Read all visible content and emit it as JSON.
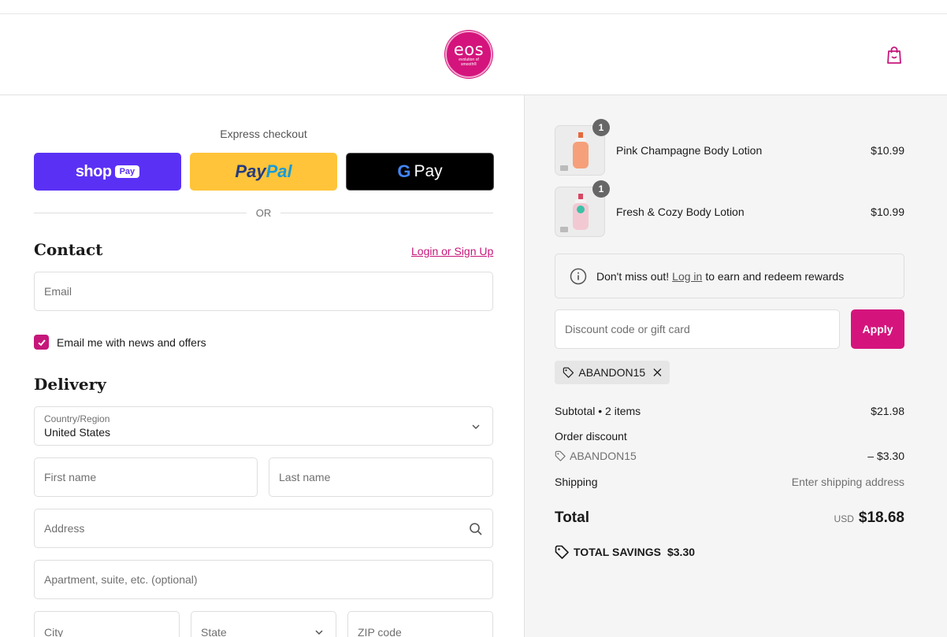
{
  "header": {
    "logo_word": "eos",
    "logo_tagline": "evolution of smooth®",
    "cart_icon": "shopping-bag-icon"
  },
  "express": {
    "title": "Express checkout",
    "shop_pay": {
      "word": "shop",
      "pill": "Pay"
    },
    "paypal": {
      "pay": "Pay",
      "pal": "Pal"
    },
    "gpay": {
      "g": "G",
      "pay": "Pay"
    },
    "or": "OR"
  },
  "contact": {
    "title": "Contact",
    "login_link": "Login or Sign Up",
    "email_placeholder": "Email",
    "newsletter_label": "Email me with news and offers",
    "newsletter_checked": true
  },
  "delivery": {
    "title": "Delivery",
    "country_label": "Country/Region",
    "country_value": "United States",
    "first_name": "First name",
    "last_name": "Last name",
    "address": "Address",
    "apartment": "Apartment, suite, etc. (optional)",
    "city": "City",
    "state": "State",
    "zip": "ZIP code"
  },
  "cart": {
    "items": [
      {
        "name": "Pink Champagne Body Lotion",
        "price": "$10.99",
        "qty": "1",
        "color": "#f5a07a"
      },
      {
        "name": "Fresh & Cozy Body Lotion",
        "price": "$10.99",
        "qty": "1",
        "color": "#f2c9d3"
      }
    ],
    "rewards": {
      "prefix": "Don't miss out!",
      "link": "Log in",
      "suffix": "to earn and redeem rewards"
    },
    "discount_placeholder": "Discount code or gift card",
    "apply_label": "Apply",
    "applied_code": "ABANDON15",
    "summary": {
      "subtotal_label": "Subtotal • 2 items",
      "subtotal_value": "$21.98",
      "order_discount_label": "Order discount",
      "discount_code": "ABANDON15",
      "discount_value": "– $3.30",
      "shipping_label": "Shipping",
      "shipping_value": "Enter shipping address",
      "total_label": "Total",
      "currency": "USD",
      "total_value": "$18.68",
      "savings_label": "TOTAL SAVINGS",
      "savings_value": "$3.30"
    }
  },
  "colors": {
    "accent": "#d4147c",
    "link": "#c6177a",
    "shop_pay": "#5a31f4",
    "paypal": "#ffc439"
  }
}
